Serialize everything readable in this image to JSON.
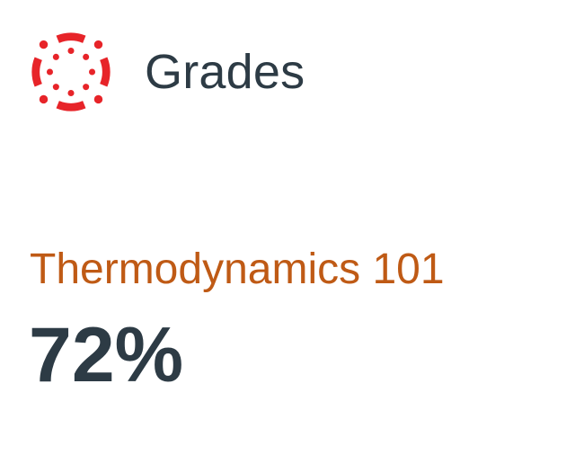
{
  "header": {
    "logo_icon": "canvas-logo-icon",
    "title": "Grades"
  },
  "course": {
    "name": "Thermodynamics 101",
    "grade": "72%"
  },
  "colors": {
    "brand_red": "#e72429",
    "course_accent": "#bf5a15",
    "text_dark": "#2d3b45"
  }
}
